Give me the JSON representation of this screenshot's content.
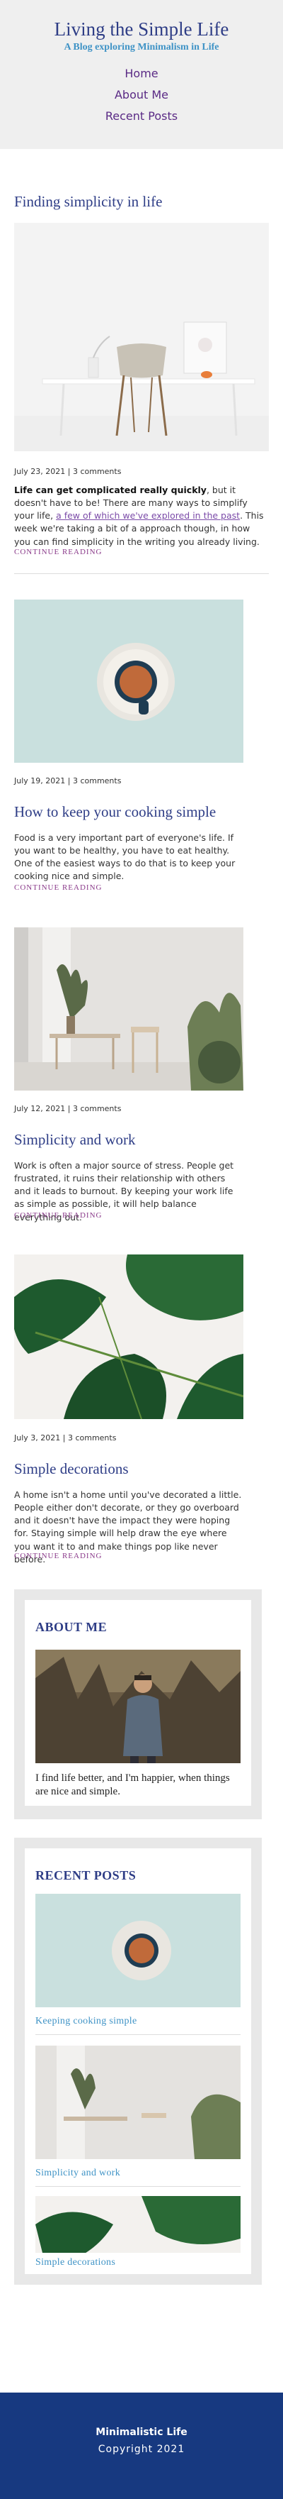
{
  "site": {
    "title": "Living the Simple Life",
    "tagline": "A Blog exploring Minimalism in Life"
  },
  "nav": [
    "Home",
    "About Me",
    "Recent Posts"
  ],
  "posts": [
    {
      "title": "Finding simplicity in life",
      "meta": "July 23, 2021 | 3 comments",
      "lead": "Life can get complicated really quickly",
      "text1": ", but it doesn't have to be! There are many ways to simplify your life, ",
      "link": "a few of which we've explored in the past",
      "text2": ". This week we're taking a bit of a approach though, in how you can find simplicity in the writing you already living.",
      "more": "CONTINUE READING"
    },
    {
      "title": "How to keep your cooking simple",
      "meta": "July 19, 2021 | 3 comments",
      "text": "Food is a very important part of everyone's life. If you want to be healthy, you have to eat healthy. One of the easiest ways to do that is to keep your cooking nice and simple.",
      "more": "CONTINUE READING"
    },
    {
      "title": "Simplicity and work",
      "meta": "July 12, 2021 | 3 comments",
      "text": "Work is often a major source of stress. People get frustrated, it ruins their relationship with others and it leads to burnout. By keeping your work life as simple as possible, it will help balance everything out.",
      "more": "CONTINUE READING"
    },
    {
      "title": "Simple decorations",
      "meta": "July 3, 2021 | 3 comments",
      "text": "A home isn't a home until you've decorated a little. People either don't decorate, or they go overboard and it doesn't have the impact they were hoping for. Staying simple will help draw the eye where you want it to and make things pop like never before.",
      "more": "CONTINUE READING"
    }
  ],
  "about": {
    "title": "ABOUT ME",
    "text": "I find life better, and I'm happier, when things are nice and simple."
  },
  "recent": {
    "title": "RECENT POSTS",
    "items": [
      "Keeping cooking simple",
      "Simplicity and work",
      "Simple decorations"
    ]
  },
  "footer": {
    "name": "Minimalistic Life",
    "copy": "Copyright 2021"
  },
  "colors": {
    "heading": "#2e3d86",
    "accent": "#3f93c6",
    "nav": "#5a2a85",
    "footer": "#173980",
    "header_bg": "#efefef"
  }
}
